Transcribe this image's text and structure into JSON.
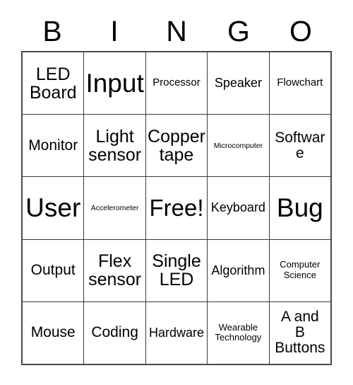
{
  "card": {
    "title": "BINGO",
    "header_letters": [
      "B",
      "I",
      "N",
      "G",
      "O"
    ],
    "colors": {
      "background": "#ffffff",
      "cell_background": "#ffffff",
      "border": "#3a3a3a",
      "outer_border": "#4a4a4a",
      "text": "#000000"
    },
    "rows": [
      [
        {
          "text": "LED\nBoard",
          "size": "lg"
        },
        {
          "text": "Input",
          "size": "xxl"
        },
        {
          "text": "Processor",
          "size": "xs"
        },
        {
          "text": "Speaker",
          "size": "sm"
        },
        {
          "text": "Flowchart",
          "size": "xs"
        }
      ],
      [
        {
          "text": "Monitor",
          "size": "md"
        },
        {
          "text": "Light\nsensor",
          "size": "lg"
        },
        {
          "text": "Copper\ntape",
          "size": "lg"
        },
        {
          "text": "Microcomputer",
          "size": "tiny"
        },
        {
          "text": "Software",
          "size": "md"
        }
      ],
      [
        {
          "text": "User",
          "size": "xxl"
        },
        {
          "text": "Accelerometer",
          "size": "tiny"
        },
        {
          "text": "Free!",
          "size": "xl"
        },
        {
          "text": "Keyboard",
          "size": "sm"
        },
        {
          "text": "Bug",
          "size": "xxl"
        }
      ],
      [
        {
          "text": "Output",
          "size": "md"
        },
        {
          "text": "Flex\nsensor",
          "size": "lg"
        },
        {
          "text": "Single\nLED",
          "size": "lg"
        },
        {
          "text": "Algorithm",
          "size": "sm"
        },
        {
          "text": "Computer\nScience",
          "size": "xxs"
        }
      ],
      [
        {
          "text": "Mouse",
          "size": "md"
        },
        {
          "text": "Coding",
          "size": "md"
        },
        {
          "text": "Hardware",
          "size": "sm"
        },
        {
          "text": "Wearable\nTechnology",
          "size": "xxs"
        },
        {
          "text": "A and\nB\nButtons",
          "size": "md"
        }
      ]
    ]
  }
}
